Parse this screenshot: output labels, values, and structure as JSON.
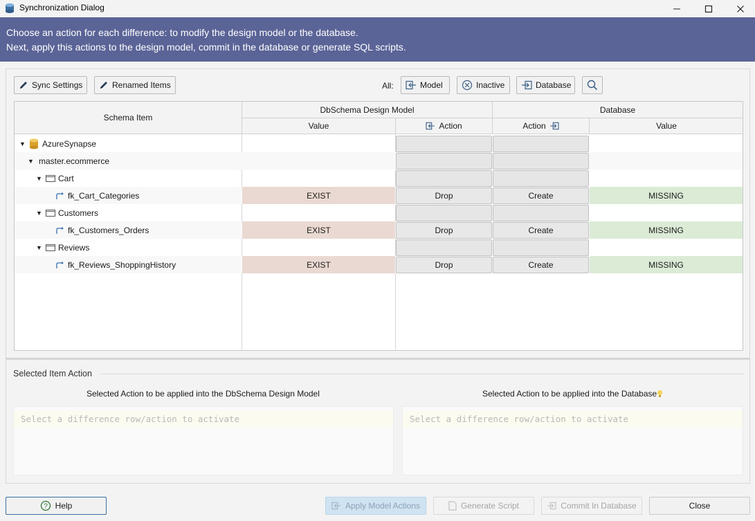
{
  "window": {
    "title": "Synchronization Dialog"
  },
  "banner": {
    "line1": "Choose an action for each difference: to modify the design model or the database.",
    "line2": "Next, apply this actions to the design model, commit in the database or generate SQL scripts."
  },
  "toolbar": {
    "sync_settings": "Sync Settings",
    "renamed_items": "Renamed Items",
    "all_label": "All:",
    "model": "Model",
    "inactive": "Inactive",
    "database": "Database"
  },
  "grid": {
    "headers": {
      "schema_item": "Schema Item",
      "design_model": "DbSchema Design Model",
      "database": "Database",
      "value_left": "Value",
      "action_left": "Action",
      "action_right": "Action",
      "value_right": "Value"
    },
    "rows": [
      {
        "label": "AzureSynapse",
        "kind": "database"
      },
      {
        "label": "master.ecommerce",
        "kind": "schema"
      },
      {
        "label": "Cart",
        "kind": "table"
      },
      {
        "label": "fk_Cart_Categories",
        "kind": "fk",
        "model_value": "EXIST",
        "model_action": "Drop",
        "db_action": "Create",
        "db_value": "MISSING"
      },
      {
        "label": "Customers",
        "kind": "table"
      },
      {
        "label": "fk_Customers_Orders",
        "kind": "fk",
        "model_value": "EXIST",
        "model_action": "Drop",
        "db_action": "Create",
        "db_value": "MISSING"
      },
      {
        "label": "Reviews",
        "kind": "table"
      },
      {
        "label": "fk_Reviews_ShoppingHistory",
        "kind": "fk",
        "model_value": "EXIST",
        "model_action": "Drop",
        "db_action": "Create",
        "db_value": "MISSING"
      }
    ]
  },
  "selected": {
    "title": "Selected Item Action",
    "model_label": "Selected Action to be applied into the DbSchema Design Model",
    "db_label": "Selected Action to be applied into the Database",
    "model_placeholder": "Select a difference row/action to activate",
    "db_placeholder": "Select a difference row/action to activate"
  },
  "footer": {
    "help": "Help",
    "apply_model": "Apply Model Actions",
    "generate_script": "Generate Script",
    "commit_db": "Commit In Database",
    "close": "Close"
  },
  "colors": {
    "banner": "#5b6497",
    "exist_bg": "#ead9d2",
    "missing_bg": "#dbebd6"
  }
}
